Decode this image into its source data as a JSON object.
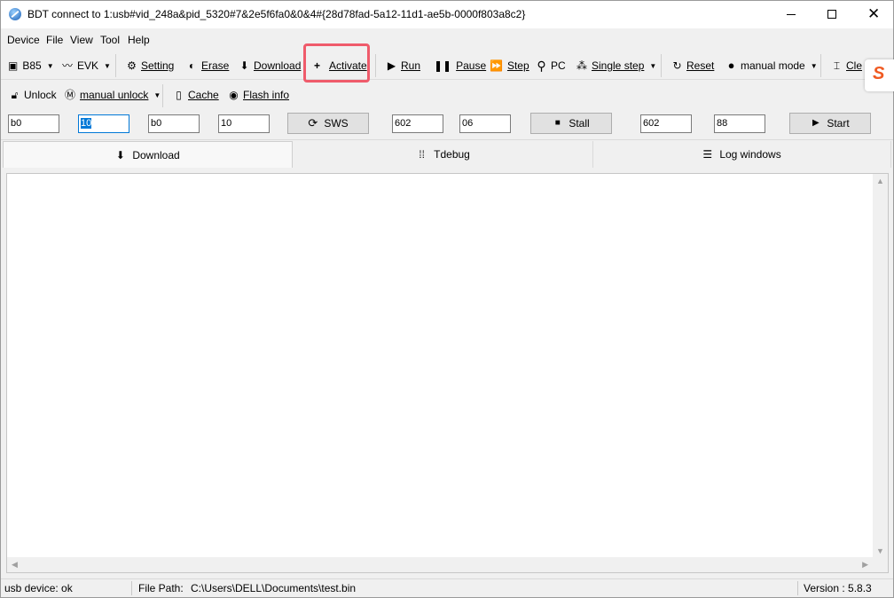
{
  "window": {
    "title": "BDT connect to 1:usb#vid_248a&pid_5320#7&2e5f6fa0&0&4#{28d78fad-5a12-11d1-ae5b-0000f803a8c2}"
  },
  "menu": [
    "Device",
    "File",
    "View",
    "Tool",
    "Help"
  ],
  "toolbar1": {
    "chip": "B85",
    "board": "EVK",
    "setting": "Setting",
    "erase": "Erase",
    "download": "Download",
    "activate": "Activate",
    "run": "Run",
    "pause": "Pause",
    "step": "Step",
    "pc": "PC",
    "single_step": "Single step",
    "reset": "Reset",
    "manual_mode": "manual mode",
    "clear": "Cle"
  },
  "toolbar2": {
    "unlock": "Unlock",
    "manual_unlock": "manual unlock",
    "cache": "Cache",
    "flash_info": "Flash info"
  },
  "inputs": {
    "f1": "b0",
    "f2": "10",
    "f3": "b0",
    "f4": "10",
    "sws": "SWS",
    "f5": "602",
    "f6": "06",
    "stall": "Stall",
    "f7": "602",
    "f8": "88",
    "start": "Start"
  },
  "tabs": {
    "download": "Download",
    "tdebug": "Tdebug",
    "log": "Log windows"
  },
  "status": {
    "device": "usb device: ok",
    "file_label": "File Path:",
    "file_path": "C:\\Users\\DELL\\Documents\\test.bin",
    "version": "Version : 5.8.3"
  },
  "colors": {
    "highlight": "#ef5b6b",
    "selection": "#0078d7",
    "ime_logo": "#f05a22"
  }
}
